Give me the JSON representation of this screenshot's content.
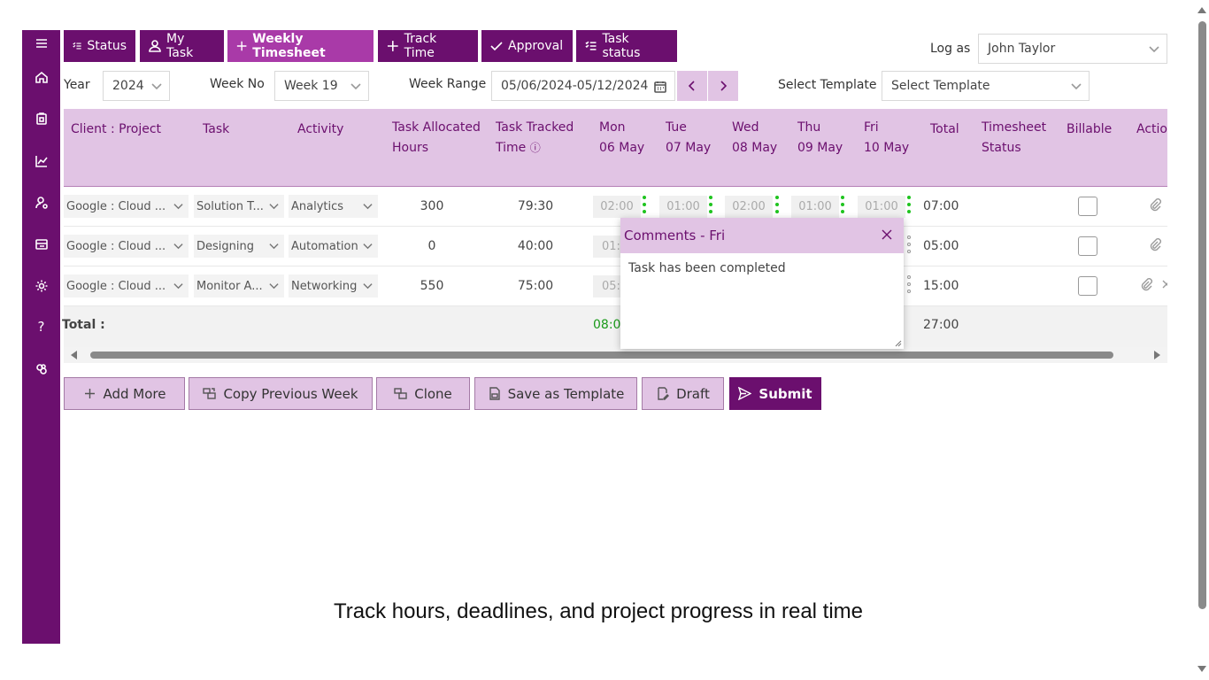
{
  "tabs": [
    {
      "label": "Status",
      "icon": "list-check-icon"
    },
    {
      "label": "My Task",
      "icon": "user-icon"
    },
    {
      "label": "Weekly Timesheet",
      "icon": "plus-icon"
    },
    {
      "label": "Track Time",
      "icon": "plus-icon"
    },
    {
      "label": "Approval",
      "icon": "check-icon"
    },
    {
      "label": "Task status",
      "icon": "list-check-icon"
    }
  ],
  "log_as": {
    "label": "Log as",
    "value": "John Taylor"
  },
  "filters": {
    "year_label": "Year",
    "year_value": "2024",
    "week_label": "Week No",
    "week_value": "Week 19",
    "range_label": "Week Range",
    "range_value": "05/06/2024-05/12/2024",
    "template_label": "Select Template",
    "template_value": "Select Template"
  },
  "columns": {
    "client_project": "Client : Project",
    "task": "Task",
    "activity": "Activity",
    "allocated_1": "Task Allocated",
    "allocated_2": "Hours",
    "tracked_1": "Task Tracked",
    "tracked_2": "Time",
    "tracked_info": "ⓘ",
    "mon_1": "Mon",
    "mon_2": "06 May",
    "tue_1": "Tue",
    "tue_2": "07 May",
    "wed_1": "Wed",
    "wed_2": "08 May",
    "thu_1": "Thu",
    "thu_2": "09 May",
    "fri_1": "Fri",
    "fri_2": "10 May",
    "total": "Total",
    "status_1": "Timesheet",
    "status_2": "Status",
    "billable": "Billable",
    "action": "Actio"
  },
  "rows": [
    {
      "client": "Google : Cloud ...",
      "task": "Solution T...",
      "activity": "Analytics",
      "allocated": "300",
      "tracked": "79:30",
      "mon": "02:00",
      "tue": "01:00",
      "wed": "02:00",
      "thu": "01:00",
      "fri": "01:00",
      "total": "07:00"
    },
    {
      "client": "Google : Cloud ...",
      "task": "Designing",
      "activity": "Automation",
      "allocated": "0",
      "tracked": "40:00",
      "mon": "01:0",
      "total": "05:00"
    },
    {
      "client": "Google : Cloud ...",
      "task": "Monitor A...",
      "activity": "Networking",
      "allocated": "550",
      "tracked": "75:00",
      "mon": "05:0",
      "total": "15:00"
    }
  ],
  "totals": {
    "label": "Total :",
    "mon": "08:0",
    "grand": "27:00"
  },
  "popup": {
    "title": "Comments - Fri",
    "text": "Task has been completed"
  },
  "actions": {
    "add_more": "Add More",
    "copy_prev": "Copy Previous Week",
    "clone": "Clone",
    "save_template": "Save as Template",
    "draft": "Draft",
    "submit": "Submit"
  },
  "tagline": "Track hours, deadlines, and project progress in real time",
  "colors": {
    "brand": "#6b0f6e",
    "active_tab": "#a93aa8",
    "header_bg": "#e1c4e4",
    "dot_green": "#1fc41f"
  }
}
